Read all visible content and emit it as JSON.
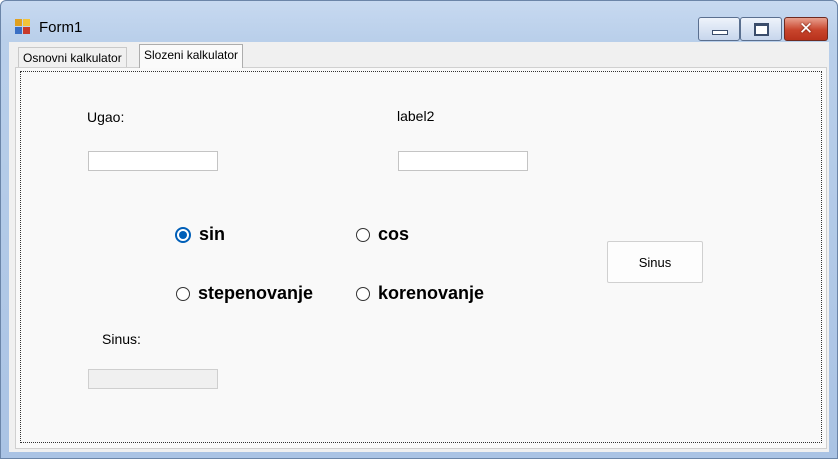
{
  "window": {
    "title": "Form1",
    "icons": {
      "app": "windows-form-icon",
      "minimize": "minimize-icon",
      "maximize": "maximize-icon",
      "close": "close-icon"
    },
    "close_glyph": "✕",
    "colors": {
      "close_button": "#c8442c",
      "titlebar": "#b9cfea"
    }
  },
  "tabs": [
    {
      "label": "Osnovni kalkulator",
      "selected": false
    },
    {
      "label": "Slozeni kalkulator",
      "selected": true
    }
  ],
  "form": {
    "input1_label": "Ugao:",
    "input1_value": "",
    "input2_label": "label2",
    "input2_value": "",
    "result_label": "Sinus:",
    "result_value": "",
    "radios": [
      {
        "label": "sin",
        "checked": true
      },
      {
        "label": "cos",
        "checked": false
      },
      {
        "label": "stepenovanje",
        "checked": false
      },
      {
        "label": "korenovanje",
        "checked": false
      }
    ],
    "action_button": "Sinus",
    "accent_color": "#005fb8"
  }
}
